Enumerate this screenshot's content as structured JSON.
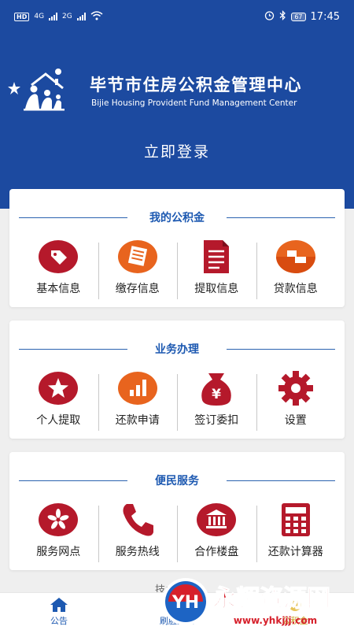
{
  "statusbar": {
    "left_text": "HD",
    "network_1": "4G",
    "network_2": "2G",
    "battery": "67",
    "time": "17:45"
  },
  "header": {
    "title_cn": "毕节市住房公积金管理中心",
    "title_en": "Bijie Housing Provident Fund Management Center",
    "login": "立即登录",
    "bg_color": "#1c4aa0"
  },
  "sections": [
    {
      "title": "我的公积金",
      "items": [
        {
          "label": "基本信息",
          "icon": "tag-icon"
        },
        {
          "label": "缴存信息",
          "icon": "document-list-icon"
        },
        {
          "label": "提取信息",
          "icon": "file-icon"
        },
        {
          "label": "贷款信息",
          "icon": "loan-icon"
        }
      ]
    },
    {
      "title": "业务办理",
      "items": [
        {
          "label": "个人提取",
          "icon": "star-icon"
        },
        {
          "label": "还款申请",
          "icon": "bar-chart-icon"
        },
        {
          "label": "签订委扣",
          "icon": "money-bag-icon"
        },
        {
          "label": "设置",
          "icon": "gear-icon"
        }
      ]
    },
    {
      "title": "便民服务",
      "items": [
        {
          "label": "服务网点",
          "icon": "flower-icon"
        },
        {
          "label": "服务热线",
          "icon": "phone-icon"
        },
        {
          "label": "合作楼盘",
          "icon": "bank-building-icon"
        },
        {
          "label": "还款计算器",
          "icon": "calculator-icon"
        }
      ]
    }
  ],
  "support_text": "技术支持",
  "bottom_nav": [
    {
      "label": "公告",
      "icon": "home-icon"
    },
    {
      "label": "刷脸登录",
      "icon": "face-scan-icon"
    },
    {
      "label": "公积金",
      "icon": "fund-icon"
    }
  ],
  "watermark": {
    "badge": "YH",
    "title": "永辉资源网",
    "url": "www.yhkjjj.com"
  },
  "colors": {
    "accent_red": "#b5192b",
    "accent_orange": "#e8641e",
    "title_blue": "#1d59b1"
  }
}
